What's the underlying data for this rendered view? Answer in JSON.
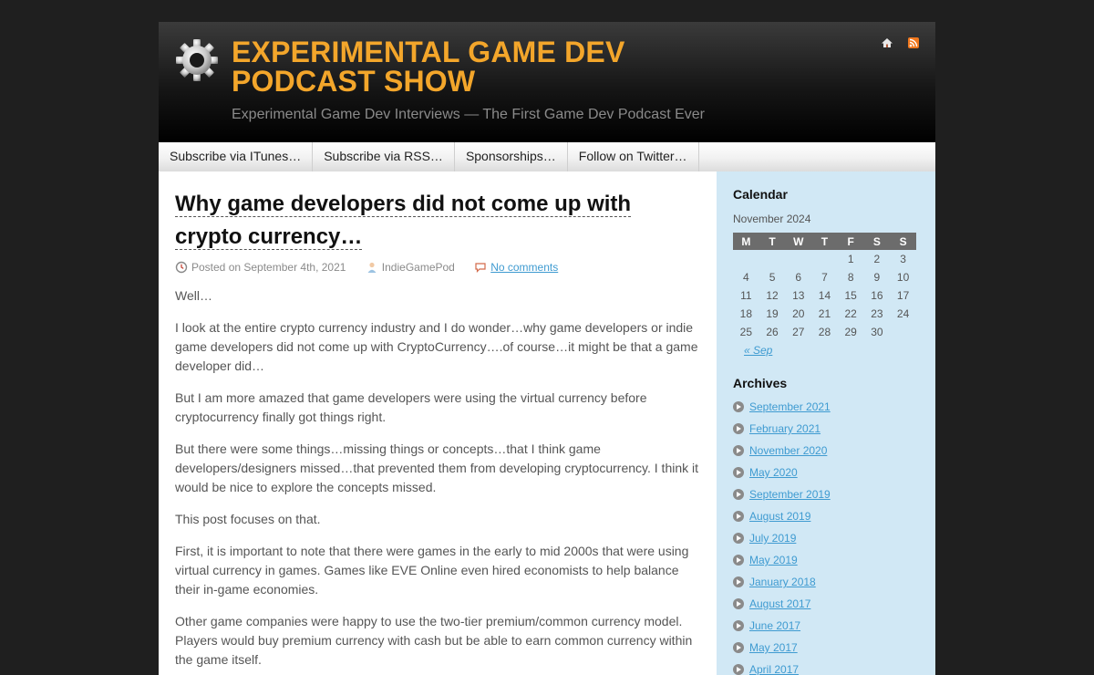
{
  "header": {
    "title_line1": "EXPERIMENTAL GAME DEV",
    "title_line2": "PODCAST SHOW",
    "description": "Experimental Game Dev Interviews — The First Game Dev Podcast Ever",
    "accent_color": "#f3a62b"
  },
  "nav": {
    "items": [
      {
        "label": "Subscribe via ITunes…"
      },
      {
        "label": "Subscribe via RSS…"
      },
      {
        "label": "Sponsorships…"
      },
      {
        "label": "Follow on Twitter…"
      }
    ]
  },
  "post": {
    "title_line1": "Why game developers did not come up with",
    "title_line2": "crypto currency…",
    "date": "Posted on September 4th, 2021",
    "author": "IndieGamePod",
    "comments": "No comments",
    "paragraphs": [
      "Well…",
      "I look at the entire crypto currency industry and I do wonder…why game developers or indie game developers did not come up with CryptoCurrency….of course…it might be that a game developer did…",
      "But I am more amazed that game developers were using the virtual currency before cryptocurrency finally got things right.",
      "But there were some things…missing things or concepts…that I think game developers/designers missed…that prevented them from developing cryptocurrency. I think it would be nice to explore the concepts missed.",
      "This post focuses on that.",
      "First, it is important to note that there were games in the early to mid 2000s that were using virtual currency in games. Games like EVE Online even hired economists to help balance their in-game economies.",
      "Other game companies were happy to use the two-tier premium/common currency model. Players would buy premium currency with cash but be able to earn common currency within the game itself."
    ]
  },
  "sidebar": {
    "calendar_heading": "Calendar",
    "calendar_caption": "November 2024",
    "weekdays": [
      "M",
      "T",
      "W",
      "T",
      "F",
      "S",
      "S"
    ],
    "weeks": [
      [
        "",
        "",
        "",
        "",
        "1",
        "2",
        "3"
      ],
      [
        "4",
        "5",
        "6",
        "7",
        "8",
        "9",
        "10"
      ],
      [
        "11",
        "12",
        "13",
        "14",
        "15",
        "16",
        "17"
      ],
      [
        "18",
        "19",
        "20",
        "21",
        "22",
        "23",
        "24"
      ],
      [
        "25",
        "26",
        "27",
        "28",
        "29",
        "30",
        ""
      ]
    ],
    "prev_link": "« Sep",
    "archives_heading": "Archives",
    "archives": [
      "September 2021",
      "February 2021",
      "November 2020",
      "May 2020",
      "September 2019",
      "August 2019",
      "July 2019",
      "May 2019",
      "January 2018",
      "August 2017",
      "June 2017",
      "May 2017",
      "April 2017"
    ],
    "background_color": "#d1e8f5",
    "link_color": "#3f9bd1"
  },
  "icons": {
    "logo": "gear-icon",
    "home": "home-icon",
    "rss": "rss-icon",
    "date": "clock-icon",
    "author": "user-icon",
    "comments": "speech-bubble-icon",
    "archive_bullet": "circle-arrow-icon"
  }
}
